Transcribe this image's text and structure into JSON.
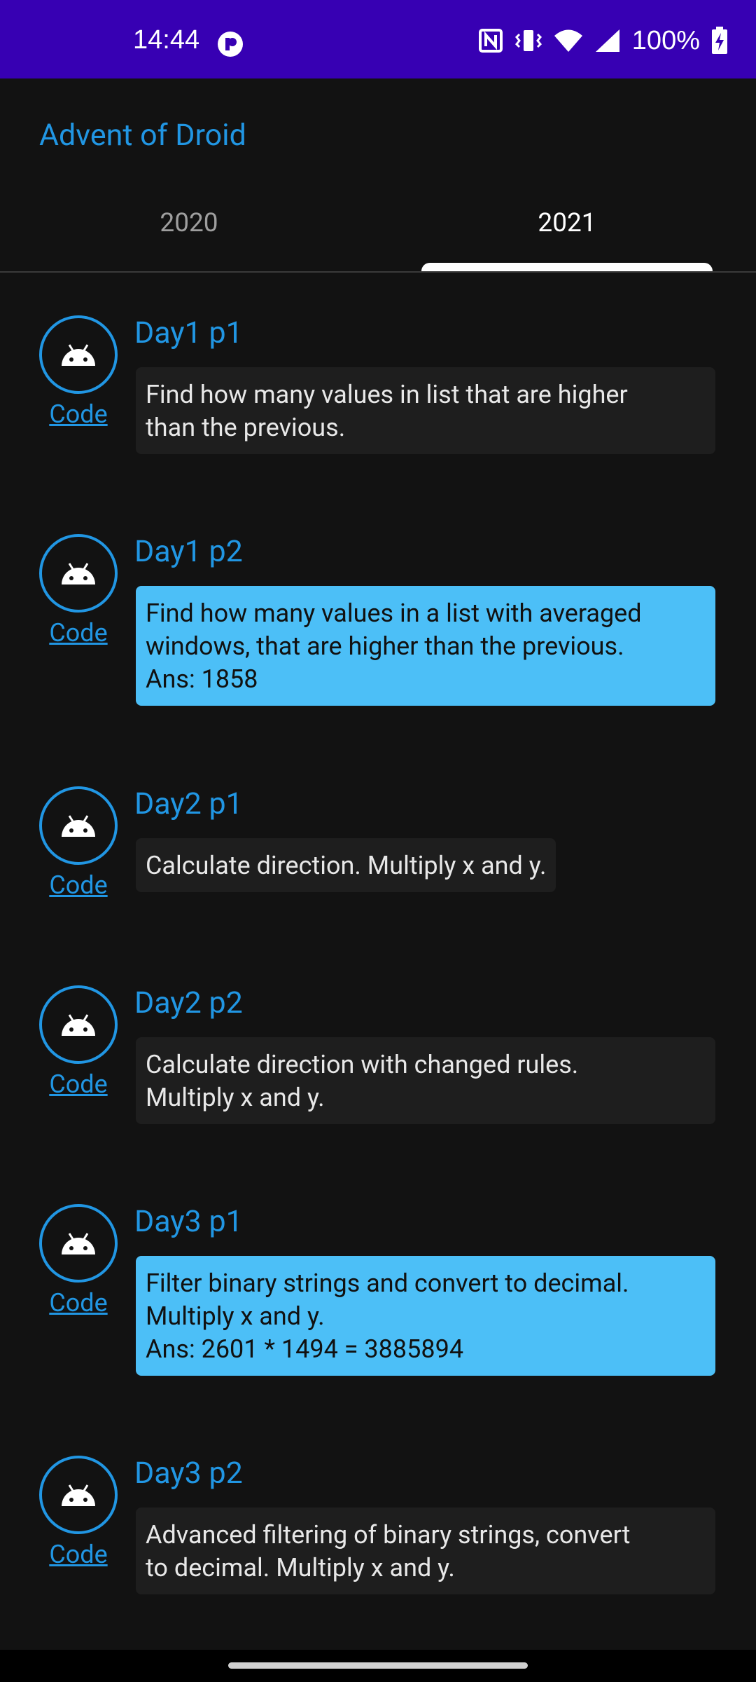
{
  "status_bar": {
    "time": "14:44",
    "battery": "100%",
    "icons": [
      "screen-record-icon",
      "nfc-icon",
      "vibrate-icon",
      "wifi-icon",
      "cell-signal-icon",
      "battery-charging-icon"
    ]
  },
  "app": {
    "title": "Advent of Droid",
    "accent": "#2196e3",
    "status_color": "#3700b3",
    "solved_color": "#4cbff7"
  },
  "tabs": [
    {
      "label": "2020",
      "selected": false
    },
    {
      "label": "2021",
      "selected": true
    }
  ],
  "items": [
    {
      "title": "Day1 p1",
      "code": "Code",
      "solved": false,
      "lines": [
        "Find how many values in list that are higher",
        "than the previous."
      ]
    },
    {
      "title": "Day1 p2",
      "code": "Code",
      "solved": true,
      "lines": [
        "Find how many values in a list with averaged",
        "windows, that are higher than the previous.",
        "Ans: 1858"
      ]
    },
    {
      "title": "Day2 p1",
      "code": "Code",
      "solved": false,
      "lines": [
        "Calculate direction. Multiply x and y."
      ]
    },
    {
      "title": "Day2 p2",
      "code": "Code",
      "solved": false,
      "lines": [
        "Calculate direction with changed rules.",
        "Multiply x and y."
      ]
    },
    {
      "title": "Day3 p1",
      "code": "Code",
      "solved": true,
      "lines": [
        "Filter binary strings and convert to decimal.",
        "Multiply x and y.",
        "Ans: 2601 * 1494 = 3885894"
      ]
    },
    {
      "title": "Day3 p2",
      "code": "Code",
      "solved": false,
      "lines": [
        "Advanced filtering of binary strings, convert",
        "to decimal. Multiply x and y."
      ]
    }
  ]
}
